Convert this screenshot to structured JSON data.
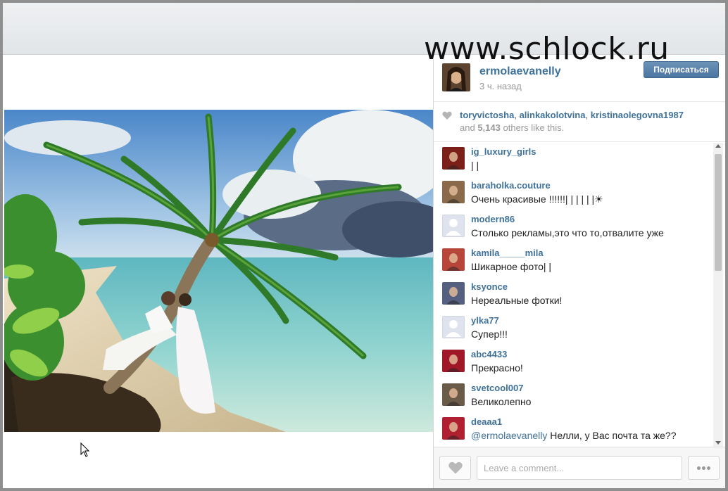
{
  "watermark": "www.schlock.ru",
  "post": {
    "owner": "ermolaevanelly",
    "time": "3 ч. назад",
    "follow_label": "Подписаться"
  },
  "likes": {
    "users": [
      "toryvictosha",
      "alinkakolotvina",
      "kristinaolegovna1987"
    ],
    "separator": ",",
    "and_text": "and",
    "count": "5,143",
    "others_text": "others like this."
  },
  "comments": [
    {
      "user": "ig_luxury_girls",
      "text": "| |",
      "avatar": "#7a2018"
    },
    {
      "user": "baraholka.couture",
      "text": "Очень красивые !!!!!!| | | | | |☀",
      "avatar": "#8a6a4a"
    },
    {
      "user": "modern86",
      "text": "Столько рекламы,это что то,отвалите уже",
      "avatar": "default"
    },
    {
      "user": "kamila_____mila",
      "text": "Шикарное фото| |",
      "avatar": "#b8453a"
    },
    {
      "user": "ksyonce",
      "text": "Нереальные фотки!",
      "avatar": "#556080"
    },
    {
      "user": "ylka77",
      "text": "Супер!!!",
      "avatar": "default"
    },
    {
      "user": "abc4433",
      "text": "Прекрасно!",
      "avatar": "#a01828"
    },
    {
      "user": "svetcool007",
      "text": "Великолепно",
      "avatar": "#6a5a48"
    },
    {
      "user": "deaaa1",
      "mention": "@ermolaevanelly",
      "text": " Нелли, у Вас почта та же??",
      "avatar": "#b02030"
    }
  ],
  "footer": {
    "comment_placeholder": "Leave a comment..."
  },
  "icons": {
    "like": "heart-icon",
    "more": "ellipsis-icon",
    "cursor": "mouse-pointer-icon"
  }
}
